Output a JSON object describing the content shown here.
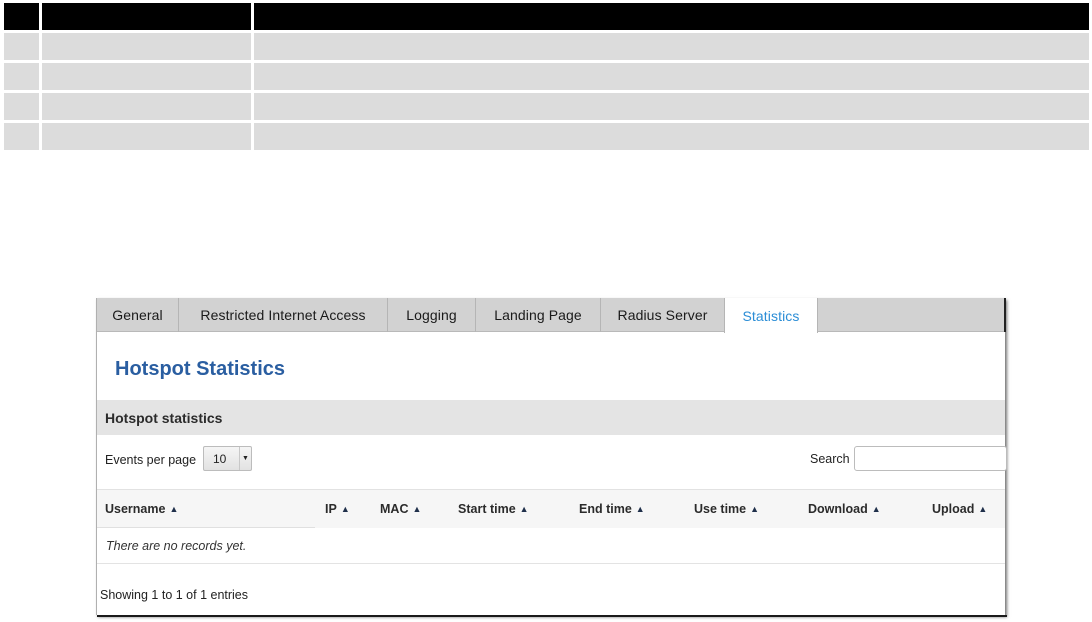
{
  "tabs": [
    {
      "label": "General",
      "active": false
    },
    {
      "label": "Restricted Internet Access",
      "active": false
    },
    {
      "label": "Logging",
      "active": false
    },
    {
      "label": "Landing Page",
      "active": false
    },
    {
      "label": "Radius Server",
      "active": false
    },
    {
      "label": "Statistics",
      "active": true
    }
  ],
  "page": {
    "title": "Hotspot Statistics",
    "section_title": "Hotspot statistics"
  },
  "controls": {
    "events_per_page_label": "Events per page",
    "events_per_page_value": "10",
    "search_label": "Search",
    "search_value": ""
  },
  "table": {
    "columns": [
      "Username",
      "IP",
      "MAC",
      "Start time",
      "End time",
      "Use time",
      "Download",
      "Upload"
    ],
    "sort_icon": "arrow-up-icon",
    "empty_message": "There are no records yet.",
    "info": "Showing 1 to 1 of 1 entries"
  },
  "colors": {
    "active_tab": "#2b8dd6",
    "title": "#2a5ea1",
    "tab_bar": "#d2d2d2",
    "section_bar": "#e4e4e4"
  }
}
